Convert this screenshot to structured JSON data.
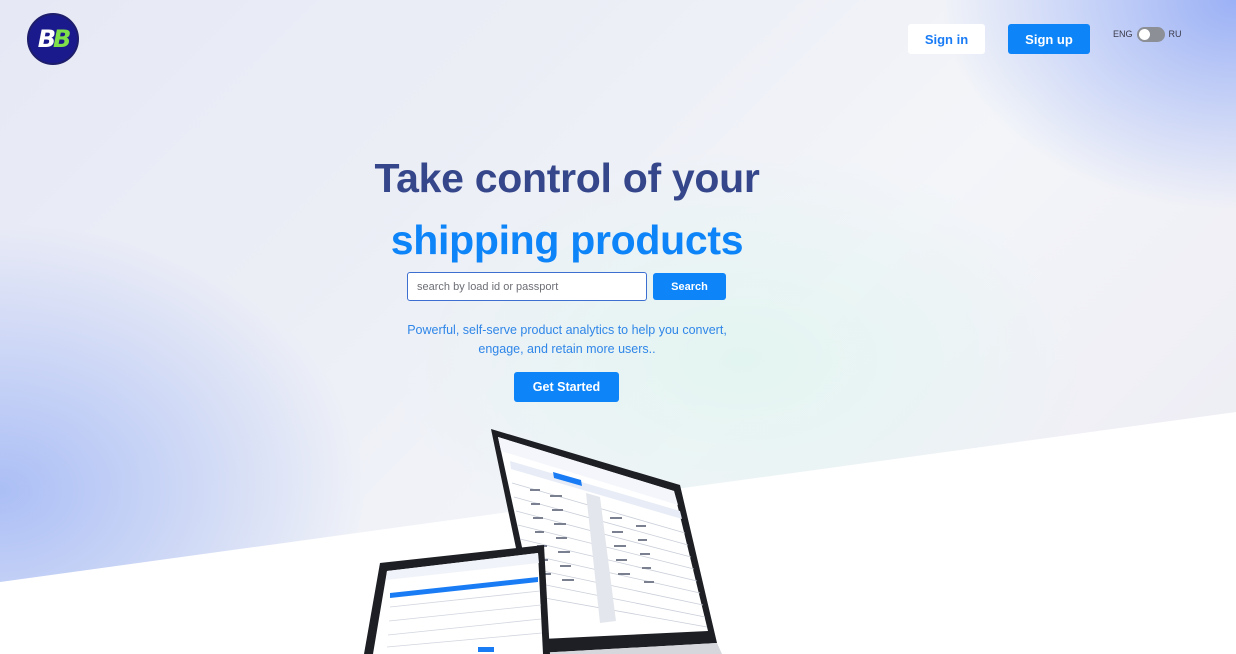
{
  "header": {
    "logo_alt": "BB",
    "signin_label": "Sign in",
    "signup_label": "Sign up",
    "lang": {
      "left": "ENG",
      "right": "RU",
      "selected": "ENG"
    }
  },
  "hero": {
    "title_line1": "Take control of your",
    "title_line2": "shipping products",
    "search": {
      "placeholder": "search by load id or passport",
      "value": "",
      "button_label": "Search"
    },
    "subtitle_line1": "Powerful, self-serve product analytics to help you convert,",
    "subtitle_line2": "engage, and retain more users..",
    "cta_label": "Get Started"
  },
  "colors": {
    "primary": "#0d84f8",
    "title_dark": "#35478a",
    "logo_bg": "#1a1a8c",
    "logo_accent": "#7fe04a"
  }
}
